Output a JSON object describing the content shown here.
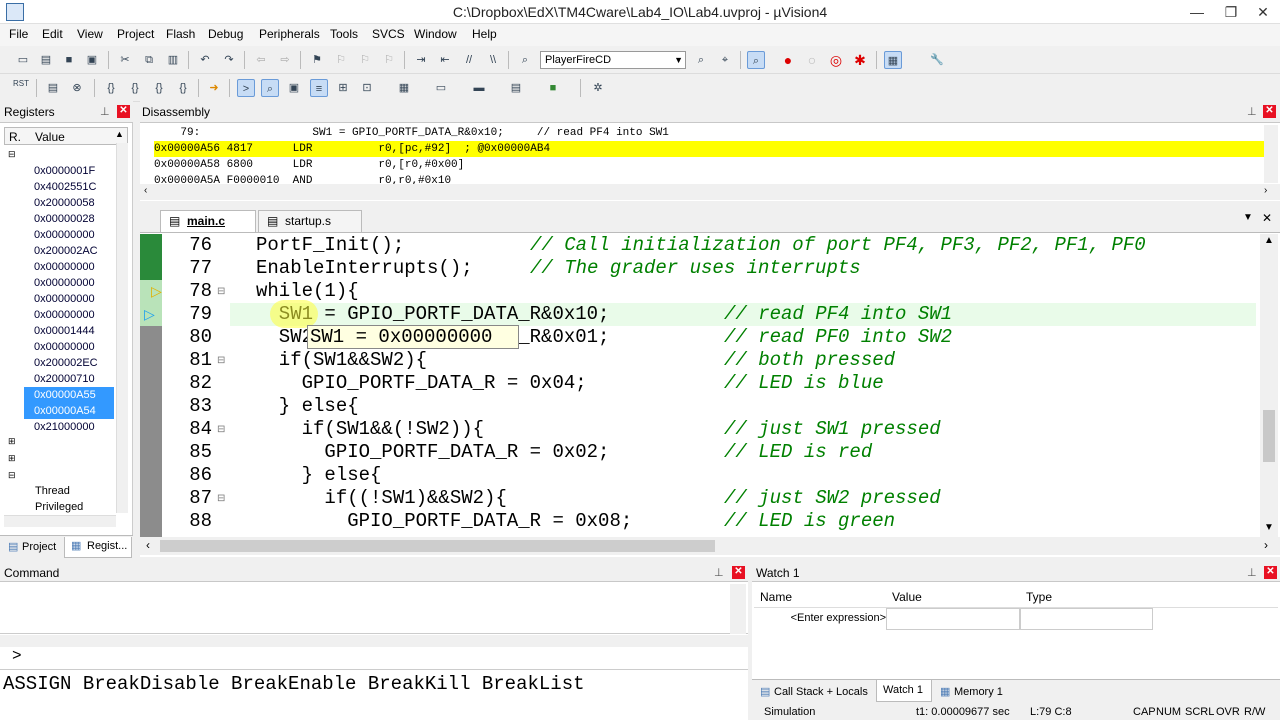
{
  "window": {
    "title": "C:\\Dropbox\\EdX\\TM4Cware\\Lab4_IO\\Lab4.uvproj - µVision4",
    "minimize": "—",
    "maximize": "❐",
    "close": "✕"
  },
  "menu": [
    "File",
    "Edit",
    "View",
    "Project",
    "Flash",
    "Debug",
    "Peripherals",
    "Tools",
    "SVCS",
    "Window",
    "Help"
  ],
  "toolbar": {
    "target_combo": "PlayerFireCD"
  },
  "registers": {
    "title": "Registers",
    "col_r": "R.",
    "col_value": "Value",
    "values": [
      "0x0000001F",
      "0x4002551C",
      "0x20000058",
      "0x00000028",
      "0x00000000",
      "0x200002AC",
      "0x00000000",
      "0x00000000",
      "0x00000000",
      "0x00000000",
      "0x00001444",
      "0x00000000",
      "0x200002EC",
      "0x20000710",
      "0x00000A55",
      "0x00000A54",
      "0x21000000"
    ],
    "selected": [
      14,
      15
    ],
    "thread": "Thread",
    "privileged": "Privileged",
    "tab_project": "Project",
    "tab_registers": "Regist..."
  },
  "disassembly": {
    "title": "Disassembly",
    "lines": [
      {
        "text": "    79:                 SW1 = GPIO_PORTF_DATA_R&0x10;     // read PF4 into SW1",
        "hl": false
      },
      {
        "text": "0x00000A56 4817      LDR          r0,[pc,#92]  ; @0x00000AB4",
        "hl": true
      },
      {
        "text": "0x00000A58 6800      LDR          r0,[r0,#0x00]",
        "hl": false
      },
      {
        "text": "0x00000A5A F0000010  AND          r0,r0,#0x10",
        "hl": false
      }
    ]
  },
  "editor": {
    "tabs": [
      "main.c",
      "startup.s"
    ],
    "line_numbers": [
      "76",
      "77",
      "78",
      "79",
      "80",
      "81",
      "82",
      "83",
      "84",
      "85",
      "86",
      "87",
      "88"
    ],
    "lines": [
      {
        "code": "PortF_Init();",
        "comment": "// Call initialization of port PF4, PF3, PF2, PF1, PF0"
      },
      {
        "code": "EnableInterrupts();",
        "comment": "// The grader uses interrupts"
      },
      {
        "code": "while(1){",
        "comment": ""
      },
      {
        "code": "  SW1 = GPIO_PORTF_DATA_R&0x10;",
        "comment": "// read PF4 into SW1"
      },
      {
        "code": "  SW2 = GPIO_PORTF_DATA_R&0x01;",
        "comment": "// read PF0 into SW2"
      },
      {
        "code": "  if(SW1&&SW2){",
        "comment": "// both pressed"
      },
      {
        "code": "    GPIO_PORTF_DATA_R = 0x04;",
        "comment": "// LED is blue"
      },
      {
        "code": "  } else{",
        "comment": ""
      },
      {
        "code": "    if(SW1&&(!SW2)){",
        "comment": "// just SW1 pressed"
      },
      {
        "code": "      GPIO_PORTF_DATA_R = 0x02;",
        "comment": "// LED is red"
      },
      {
        "code": "    } else{",
        "comment": ""
      },
      {
        "code": "      if((!SW1)&&SW2){",
        "comment": "// just SW2 pressed"
      },
      {
        "code": "        GPIO_PORTF_DATA_R = 0x08;",
        "comment": "// LED is green"
      }
    ],
    "tooltip": "SW1 = 0x00000000"
  },
  "command": {
    "title": "Command",
    "prompt": ">",
    "hint": "ASSIGN BreakDisable BreakEnable BreakKill BreakList"
  },
  "watch": {
    "title": "Watch 1",
    "col_name": "Name",
    "col_value": "Value",
    "col_type": "Type",
    "placeholder": "<Enter expression>",
    "tabs": [
      "Call Stack + Locals",
      "Watch 1",
      "Memory 1"
    ]
  },
  "status": {
    "mode": "Simulation",
    "time": "t1: 0.00009677 sec",
    "position": "L:79 C:8",
    "caps": "CAP",
    "num": "NUM",
    "scrl": "SCRL",
    "ovr": "OVR",
    "rw": "R/W"
  }
}
